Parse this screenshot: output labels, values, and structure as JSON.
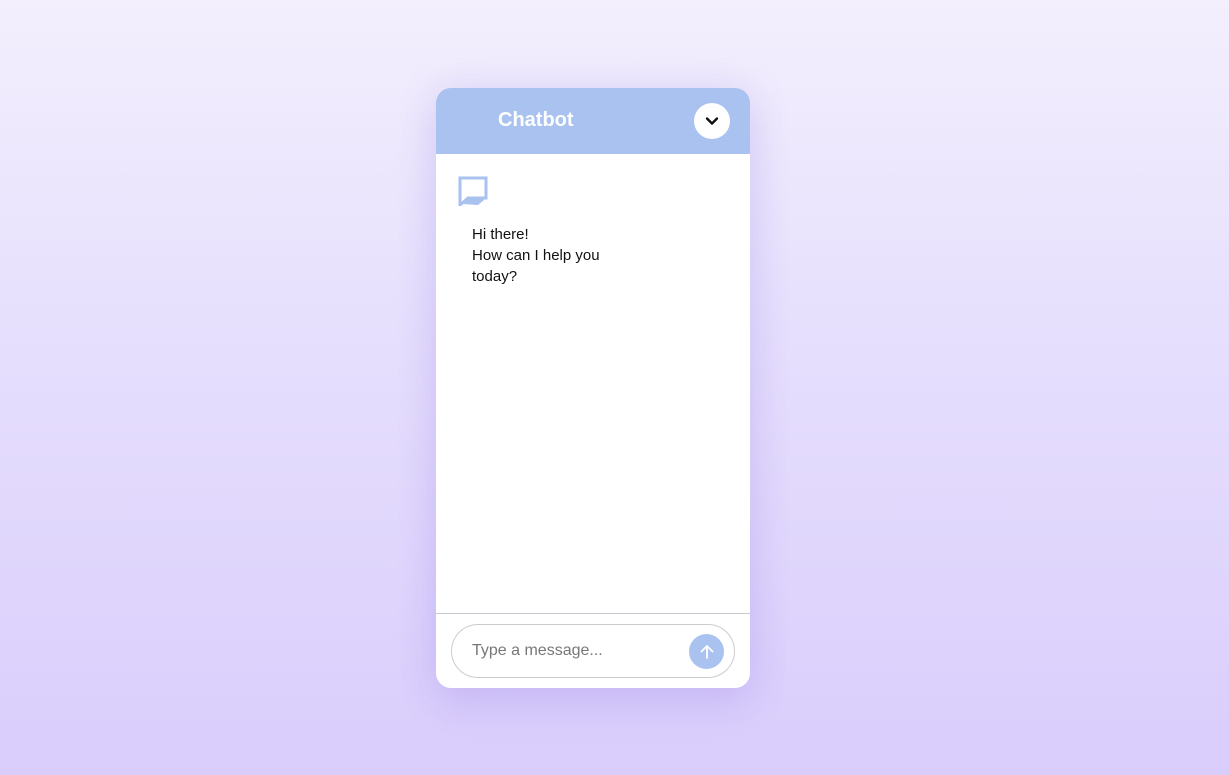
{
  "header": {
    "title": "Chatbot",
    "collapse_icon": "chevron-down-icon"
  },
  "body": {
    "avatar_icon": "chat-bubble-icon",
    "bot_message": {
      "lines": [
        "Hi there!",
        "How can I help you",
        "today?"
      ]
    }
  },
  "footer": {
    "input_placeholder": "Type a message...",
    "input_value": "",
    "send_icon": "arrow-up-icon"
  },
  "colors": {
    "accent": "#a9c2f0",
    "background_top": "#f3effd",
    "background_bottom": "#d9cdfc",
    "text": "#111111"
  }
}
